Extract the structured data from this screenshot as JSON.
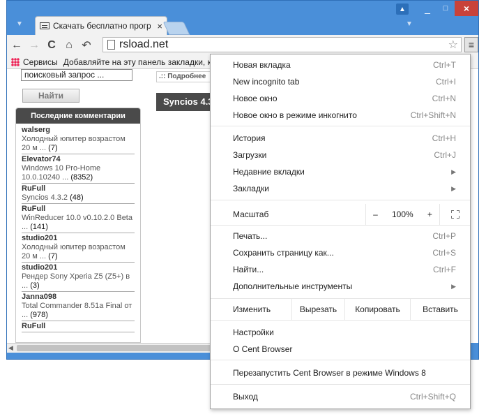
{
  "window": {
    "tab_title": "Скачать бесплатно прогр",
    "tab_close": "×",
    "user_icon": "user-icon",
    "min": "_",
    "max": "□",
    "close": "×"
  },
  "toolbar": {
    "back": "←",
    "forward": "→",
    "reload": "C",
    "home": "⌂",
    "undo_tab": "↶",
    "url": "rsload.net",
    "star": "☆",
    "menu": "≡"
  },
  "bookmarks": {
    "apps_label": "Сервисы",
    "hint": "Добавляйте на эту панель закладки, к ко"
  },
  "page": {
    "search_value": "поисковый запрос ...",
    "find_button": "Найти",
    "more_link": ".:: Подробнее",
    "syncios_title": "Syncios 4.3",
    "sidebar_title": "Последние комментарии",
    "comments": [
      {
        "user": "walserg",
        "text": "Холодный юпитер возрастом 20 м ...",
        "count": "(7)"
      },
      {
        "user": "Elevator74",
        "text": "Windows 10 Pro-Home 10.0.10240 ...",
        "count": "(8352)"
      },
      {
        "user": "RuFull",
        "text": "Syncios 4.3.2",
        "count": "(48)"
      },
      {
        "user": "RuFull",
        "text": "WinReducer 10.0 v0.10.2.0 Beta ...",
        "count": "(141)"
      },
      {
        "user": "studio201",
        "text": "Холодный юпитер возрастом 20 м ...",
        "count": "(7)"
      },
      {
        "user": "studio201",
        "text": "Рендер Sony Xperia Z5 (Z5+) в ...",
        "count": "(3)"
      },
      {
        "user": "Janna098",
        "text": "Total Commander 8.51a Final от ...",
        "count": "(978)"
      },
      {
        "user": "RuFull",
        "text": "",
        "count": ""
      }
    ]
  },
  "menu": {
    "new_tab": "Новая вкладка",
    "new_tab_sc": "Ctrl+T",
    "incognito_tab": "New incognito tab",
    "incognito_tab_sc": "Ctrl+I",
    "new_window": "Новое окно",
    "new_window_sc": "Ctrl+N",
    "new_incognito_window": "Новое окно в режиме инкогнито",
    "new_incognito_window_sc": "Ctrl+Shift+N",
    "history": "История",
    "history_sc": "Ctrl+H",
    "downloads": "Загрузки",
    "downloads_sc": "Ctrl+J",
    "recent_tabs": "Недавние вкладки",
    "bookmarks": "Закладки",
    "zoom_label": "Масштаб",
    "zoom_minus": "–",
    "zoom_value": "100%",
    "zoom_plus": "+",
    "print": "Печать...",
    "print_sc": "Ctrl+P",
    "save_page": "Сохранить страницу как...",
    "save_page_sc": "Ctrl+S",
    "find": "Найти...",
    "find_sc": "Ctrl+F",
    "more_tools": "Дополнительные инструменты",
    "edit_label": "Изменить",
    "cut": "Вырезать",
    "copy": "Копировать",
    "paste": "Вставить",
    "settings": "Настройки",
    "about": "О Cent Browser",
    "relaunch": "Перезапустить Cent Browser в режиме Windows 8",
    "exit": "Выход",
    "exit_sc": "Ctrl+Shift+Q"
  }
}
